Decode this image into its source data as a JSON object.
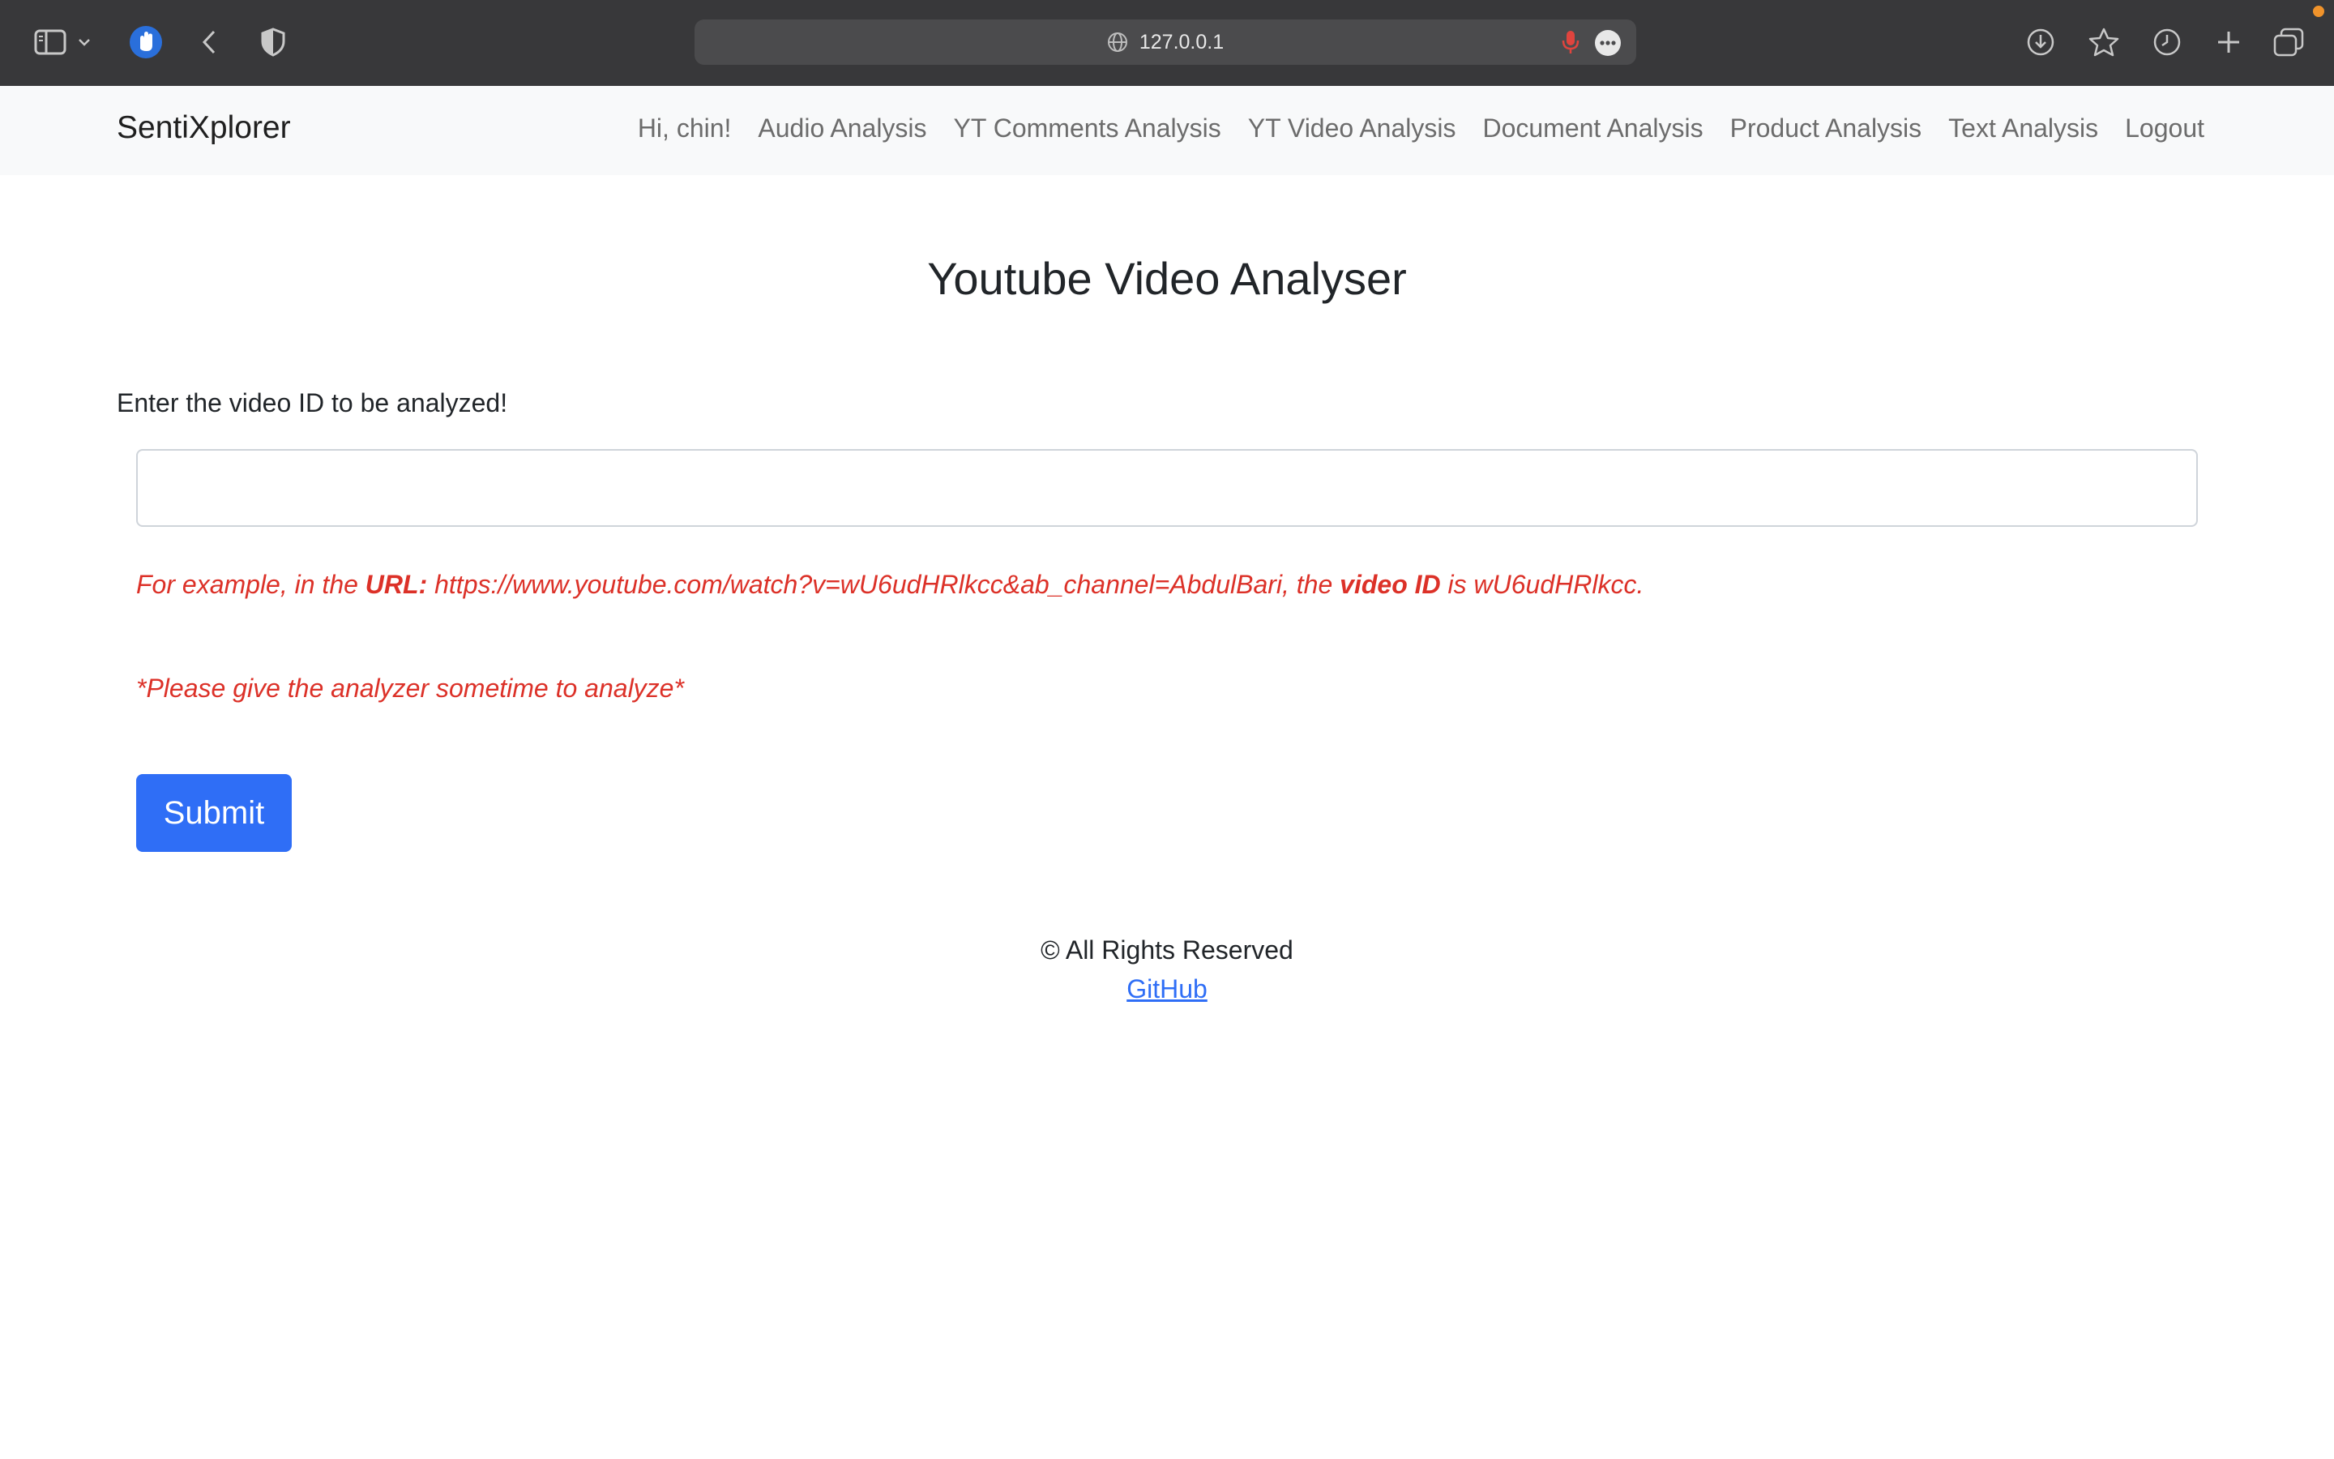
{
  "browser": {
    "url": "127.0.0.1"
  },
  "navbar": {
    "brand": "SentiXplorer",
    "links": [
      "Hi, chin!",
      "Audio Analysis",
      "YT Comments Analysis",
      "YT Video Analysis",
      "Document Analysis",
      "Product Analysis",
      "Text Analysis",
      "Logout"
    ]
  },
  "main": {
    "title": "Youtube Video Analyser",
    "input_label": "Enter the video ID to be analyzed!",
    "input_value": "",
    "example": {
      "prefix": "For example, in the ",
      "url_label": "URL:",
      "url": " https://www.youtube.com/watch?v=wU6udHRlkcc&ab_channel=AbdulBari, the ",
      "id_label": "video ID",
      "id_text": " is wU6udHRlkcc."
    },
    "wait_note": "*Please give the analyzer sometime to analyze*",
    "submit_label": "Submit"
  },
  "footer": {
    "copyright": "© All Rights Reserved",
    "github_link": "GitHub"
  },
  "colors": {
    "accent": "#2f6ef6",
    "warning_text": "#dc3128",
    "chrome_bg": "#38383a",
    "navbar_bg": "#f8f9fa"
  }
}
